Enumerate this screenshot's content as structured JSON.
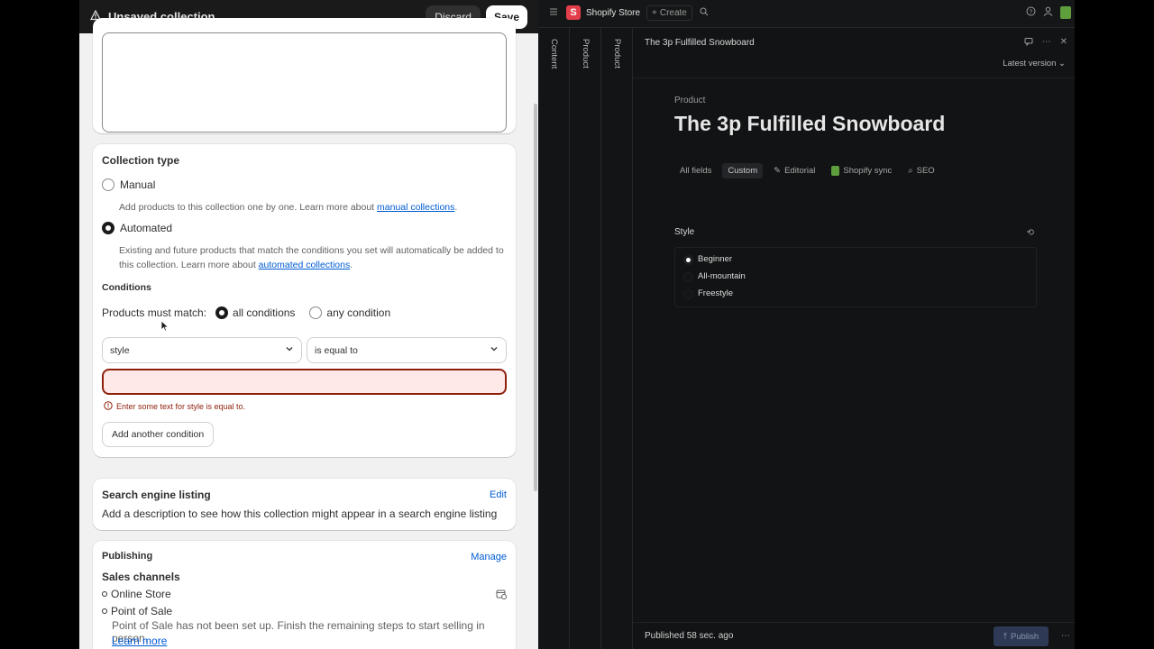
{
  "topbar": {
    "title": "Unsaved collection",
    "discard": "Discard",
    "save": "Save"
  },
  "collection_type": {
    "heading": "Collection type",
    "manual_label": "Manual",
    "manual_help": "Add products to this collection one by one. Learn more about ",
    "manual_link": "manual collections",
    "automated_label": "Automated",
    "automated_help": "Existing and future products that match the conditions you set will automatically be added to this collection. Learn more about ",
    "automated_link": "automated collections",
    "selected": "Automated"
  },
  "conditions": {
    "heading": "Conditions",
    "match_label": "Products must match:",
    "all_label": "all conditions",
    "any_label": "any condition",
    "selected_match": "all conditions",
    "field_select": "style",
    "operator_select": "is equal to",
    "value": "",
    "error": "Enter some text for style is equal to.",
    "add_button": "Add another condition"
  },
  "seo": {
    "heading": "Search engine listing",
    "edit": "Edit",
    "description": "Add a description to see how this collection might appear in a search engine listing"
  },
  "publishing": {
    "heading": "Publishing",
    "manage": "Manage",
    "channels_heading": "Sales channels",
    "channels": [
      "Online Store",
      "Point of Sale"
    ],
    "pos_note": "Point of Sale has not been set up. Finish the remaining steps to start selling in person.",
    "learn_more": "Learn more"
  },
  "studio": {
    "store_name": "Shopify Store",
    "logo_letter": "S",
    "create": "Create",
    "columns": [
      "Content",
      "Product",
      "Product"
    ],
    "doc_title": "The 3p Fulfilled Snowboard",
    "version": "Latest version",
    "type_label": "Product",
    "product_title": "The 3p Fulfilled Snowboard",
    "tabs": [
      "All fields",
      "Custom",
      "Editorial",
      "Shopify sync",
      "SEO"
    ],
    "active_tab": "Custom",
    "style_label": "Style",
    "style_options": [
      "Beginner",
      "All-mountain",
      "Freestyle"
    ],
    "style_selected": "Beginner",
    "published": "Published 58 sec. ago",
    "publish_button": "Publish"
  }
}
